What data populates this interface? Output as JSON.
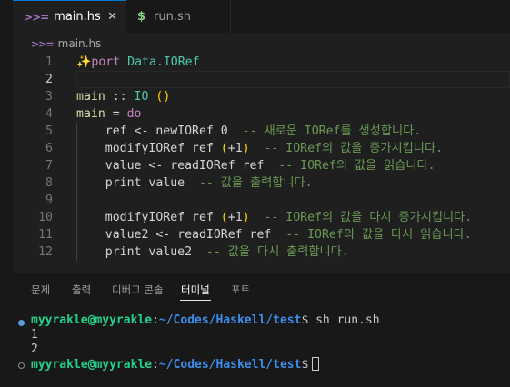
{
  "tabs": [
    {
      "icon": "haskell-icon",
      "icon_glyph": ">>=",
      "label": "main.hs",
      "close": "✕",
      "active": true
    },
    {
      "icon": "shell-icon",
      "icon_glyph": "$",
      "label": "run.sh",
      "active": false
    }
  ],
  "breadcrumb": {
    "icon": "haskell-icon",
    "icon_glyph": ">>=",
    "file": "main.hs"
  },
  "editor": {
    "current_line": 2,
    "lines": [
      {
        "n": "1",
        "spark": "✨",
        "t": [
          [
            "kw",
            "port"
          ],
          [
            "tx",
            " "
          ],
          [
            "ty",
            "Data.IORef"
          ]
        ]
      },
      {
        "n": "2",
        "t": []
      },
      {
        "n": "3",
        "t": [
          [
            "fn",
            "main"
          ],
          [
            "tx",
            " :: "
          ],
          [
            "ty",
            "IO"
          ],
          [
            "tx",
            " "
          ],
          [
            "pn",
            "()"
          ]
        ]
      },
      {
        "n": "4",
        "t": [
          [
            "fn",
            "main"
          ],
          [
            "tx",
            " = "
          ],
          [
            "kw",
            "do"
          ]
        ]
      },
      {
        "n": "5",
        "t": [
          [
            "tx",
            "    ref <- newIORef 0  "
          ],
          [
            "cm",
            "-- 새로운 IORef를 생성합니다."
          ]
        ]
      },
      {
        "n": "6",
        "t": [
          [
            "tx",
            "    modifyIORef ref "
          ],
          [
            "pn",
            "("
          ],
          [
            "tx",
            "+1"
          ],
          [
            "pn",
            ")"
          ],
          [
            "tx",
            "  "
          ],
          [
            "cm",
            "-- IORef의 값을 증가시킵니다."
          ]
        ]
      },
      {
        "n": "7",
        "t": [
          [
            "tx",
            "    value <- readIORef ref  "
          ],
          [
            "cm",
            "-- IORef의 값을 읽습니다."
          ]
        ]
      },
      {
        "n": "8",
        "t": [
          [
            "tx",
            "    print value  "
          ],
          [
            "cm",
            "-- 값을 출력합니다."
          ]
        ]
      },
      {
        "n": "9",
        "t": []
      },
      {
        "n": "10",
        "t": [
          [
            "tx",
            "    modifyIORef ref "
          ],
          [
            "pn",
            "("
          ],
          [
            "tx",
            "+1"
          ],
          [
            "pn",
            ")"
          ],
          [
            "tx",
            "  "
          ],
          [
            "cm",
            "-- IORef의 값을 다시 증가시킵니다."
          ]
        ]
      },
      {
        "n": "11",
        "t": [
          [
            "tx",
            "    value2 <- readIORef ref  "
          ],
          [
            "cm",
            "-- IORef의 값을 다시 읽습니다."
          ]
        ]
      },
      {
        "n": "12",
        "t": [
          [
            "tx",
            "    print value2  "
          ],
          [
            "cm",
            "-- 값을 다시 출력합니다."
          ]
        ]
      }
    ]
  },
  "panel": {
    "tabs": [
      "문제",
      "출력",
      "디버그 콘솔",
      "터미널",
      "포트"
    ],
    "active_tab": "터미널"
  },
  "terminal": {
    "user": "myyrakle@myyrakle",
    "sep": ":",
    "path": "~/Codes/Haskell/test",
    "prompt": "$",
    "command": "sh run.sh",
    "output": [
      "1",
      "2"
    ]
  },
  "colors": {
    "accent": "#0078d4",
    "comment": "#6a9955",
    "keyword": "#c586c0",
    "type": "#4ec9b0",
    "terminal_user": "#23d18b",
    "terminal_path": "#3b8eea"
  }
}
